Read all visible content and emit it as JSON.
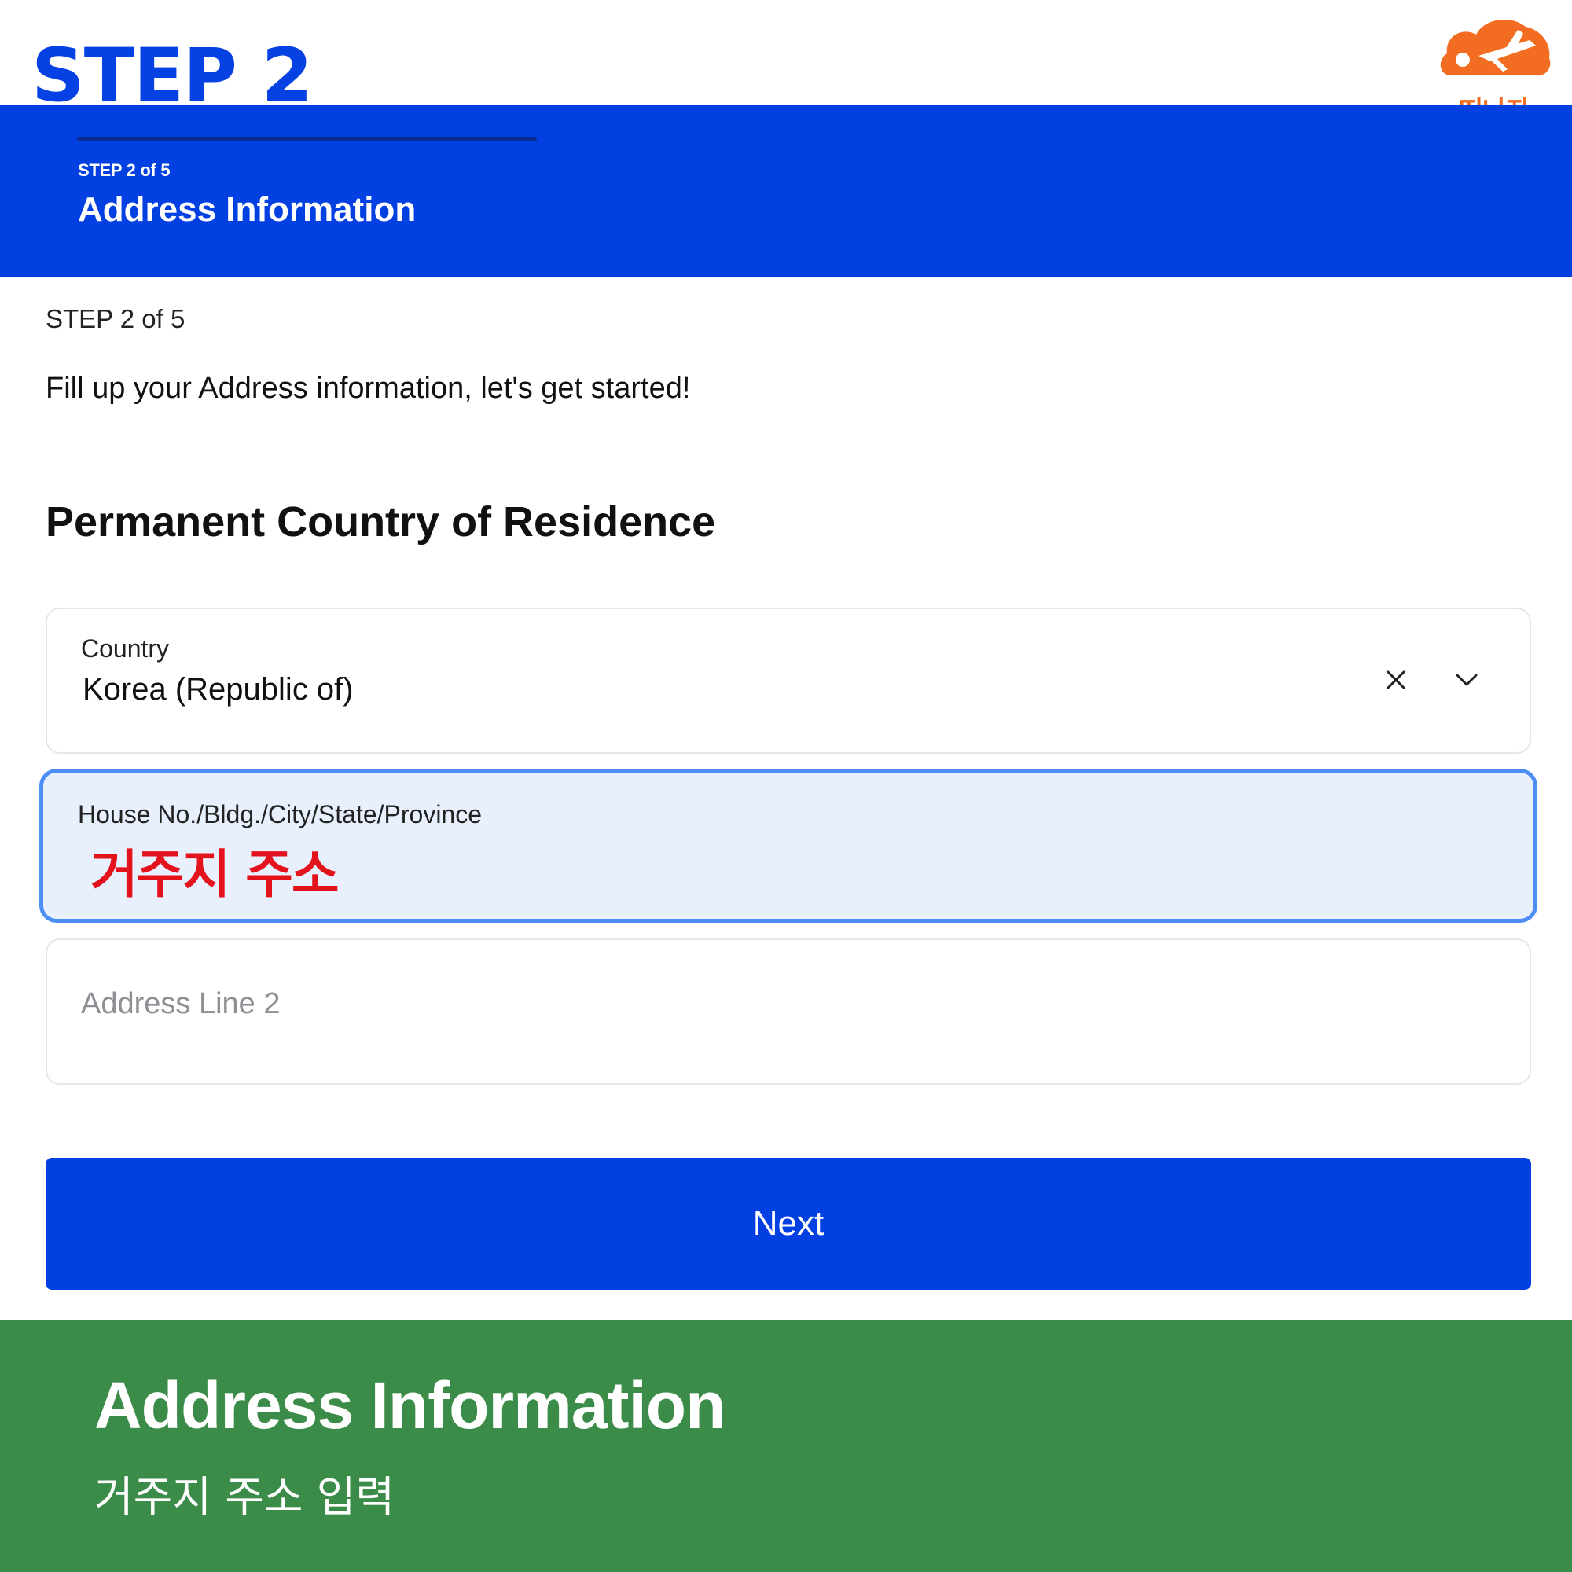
{
  "banner": {
    "step_heading": "STEP 2"
  },
  "logo": {
    "text": "떠나자",
    "color": "#f26d21"
  },
  "header": {
    "step_label": "STEP 2 of 5",
    "title": "Address Information",
    "progress_fraction": 0.4,
    "background": "#0340e2"
  },
  "main": {
    "step_label": "STEP 2 of 5",
    "intro": "Fill up your Address information, let's get started!",
    "section_title": "Permanent Country of Residence",
    "country_field": {
      "label": "Country",
      "value": "Korea (Republic of)",
      "clear_icon": "close-icon",
      "dropdown_icon": "chevron-down-icon"
    },
    "house_field": {
      "label": "House No./Bldg./City/State/Province",
      "annotation": "거주지 주소",
      "annotation_color": "#e4121d"
    },
    "line2_field": {
      "placeholder": "Address Line 2"
    },
    "next_button": "Next"
  },
  "caption": {
    "title": "Address Information",
    "subtitle": "거주지 주소 입력",
    "background": "#3b8c48"
  }
}
